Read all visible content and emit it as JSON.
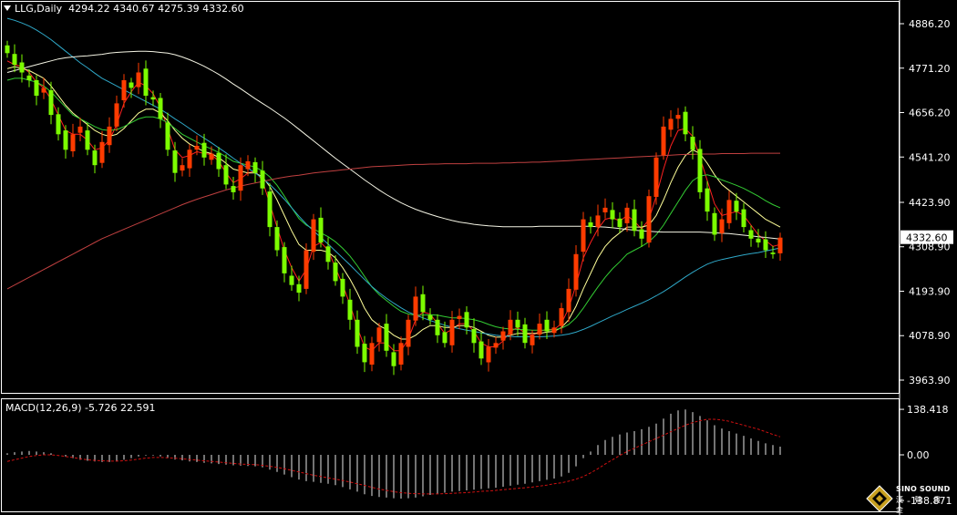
{
  "header": {
    "symbol": "LLG,Daily",
    "ohlc": "4294.22 4340.67 4275.39 4332.60"
  },
  "macd_header": {
    "label": "MACD(12,26,9) -5.726 22.591"
  },
  "logo": {
    "text": "SINO SOUND",
    "cn": "漢 聲 貴 金"
  },
  "colors": {
    "background": "#000000",
    "up_candle": "#ff3b00",
    "down_candle": "#7cfc00",
    "ma_fast": "#ff2020",
    "ma_mid": "#ffff99",
    "ma_green": "#33cc33",
    "ma_cyan": "#2fa8c8",
    "ma_white": "#f4f4e4",
    "ma_long": "#c04040",
    "macd_hist": "#e6e6e6",
    "macd_signal": "#d01010",
    "grid": "#888888"
  },
  "chart_data": [
    {
      "type": "candlestick",
      "title": "LLG,Daily",
      "y_ticks": [
        "4886.20",
        "4771.20",
        "4656.20",
        "4541.20",
        "4423.90",
        "4308.90",
        "4193.90",
        "4078.90",
        "3963.90"
      ],
      "ylim": [
        3930,
        4940
      ],
      "last_price": "4332.60",
      "grid": false,
      "series": [
        {
          "name": "price",
          "close": [
            4810,
            4780,
            4760,
            4740,
            4700,
            4720,
            4650,
            4600,
            4560,
            4600,
            4620,
            4560,
            4520,
            4580,
            4620,
            4680,
            4740,
            4720,
            4760,
            4700,
            4690,
            4640,
            4560,
            4500,
            4520,
            4560,
            4570,
            4540,
            4550,
            4510,
            4470,
            4450,
            4520,
            4530,
            4500,
            4460,
            4360,
            4300,
            4240,
            4210,
            4190,
            4300,
            4380,
            4320,
            4270,
            4220,
            4180,
            4120,
            4050,
            4010,
            4060,
            4100,
            4040,
            4000,
            4060,
            4120,
            4180,
            4140,
            4120,
            4080,
            4060,
            4120,
            4130,
            4100,
            4060,
            4020,
            4050,
            4060,
            4090,
            4120,
            4100,
            4060,
            4080,
            4110,
            4090,
            4100,
            4150,
            4200,
            4290,
            4380,
            4360,
            4390,
            4410,
            4380,
            4360,
            4410,
            4350,
            4330,
            4440,
            4540,
            4620,
            4640,
            4650,
            4600,
            4560,
            4450,
            4400,
            4340,
            4380,
            4430,
            4400,
            4360,
            4330,
            4320,
            4300,
            4290,
            4332.6
          ]
        },
        {
          "name": "fast",
          "values": [
            4790,
            4780,
            4775,
            4760,
            4735,
            4720,
            4690,
            4650,
            4610,
            4600,
            4600,
            4585,
            4560,
            4565,
            4585,
            4625,
            4680,
            4710,
            4735,
            4725,
            4705,
            4670,
            4615,
            4560,
            4540,
            4545,
            4555,
            4550,
            4548,
            4530,
            4500,
            4475,
            4485,
            4500,
            4505,
            4480,
            4420,
            4360,
            4300,
            4255,
            4220,
            4250,
            4310,
            4320,
            4300,
            4255,
            4210,
            4160,
            4100,
            4050,
            4040,
            4060,
            4060,
            4040,
            4040,
            4070,
            4120,
            4140,
            4135,
            4110,
            4085,
            4095,
            4110,
            4110,
            4090,
            4060,
            4050,
            4050,
            4065,
            4090,
            4100,
            4085,
            4080,
            4090,
            4095,
            4095,
            4110,
            4150,
            4210,
            4280,
            4320,
            4355,
            4380,
            4385,
            4375,
            4390,
            4375,
            4355,
            4380,
            4440,
            4510,
            4570,
            4610,
            4615,
            4595,
            4540,
            4480,
            4420,
            4390,
            4395,
            4400,
            4390,
            4365,
            4340,
            4325,
            4310,
            4315
          ]
        },
        {
          "name": "mid",
          "values": [
            4770,
            4775,
            4770,
            4765,
            4755,
            4745,
            4725,
            4700,
            4675,
            4655,
            4640,
            4625,
            4610,
            4600,
            4595,
            4600,
            4615,
            4635,
            4655,
            4665,
            4665,
            4655,
            4635,
            4610,
            4590,
            4575,
            4565,
            4555,
            4550,
            4540,
            4525,
            4510,
            4505,
            4500,
            4500,
            4490,
            4465,
            4430,
            4390,
            4350,
            4315,
            4300,
            4300,
            4300,
            4295,
            4280,
            4255,
            4225,
            4190,
            4150,
            4120,
            4105,
            4095,
            4080,
            4070,
            4070,
            4080,
            4095,
            4105,
            4105,
            4100,
            4100,
            4105,
            4105,
            4100,
            4090,
            4080,
            4075,
            4075,
            4080,
            4085,
            4085,
            4085,
            4085,
            4088,
            4090,
            4100,
            4120,
            4155,
            4200,
            4240,
            4280,
            4310,
            4330,
            4345,
            4360,
            4360,
            4360,
            4365,
            4390,
            4430,
            4475,
            4515,
            4545,
            4560,
            4550,
            4525,
            4495,
            4470,
            4455,
            4440,
            4425,
            4410,
            4395,
            4380,
            4370,
            4360
          ]
        },
        {
          "name": "green",
          "values": [
            4740,
            4745,
            4745,
            4740,
            4735,
            4725,
            4710,
            4690,
            4670,
            4650,
            4640,
            4630,
            4620,
            4612,
            4610,
            4612,
            4620,
            4630,
            4640,
            4645,
            4645,
            4640,
            4630,
            4615,
            4600,
            4590,
            4580,
            4570,
            4562,
            4553,
            4542,
            4530,
            4525,
            4520,
            4515,
            4505,
            4490,
            4468,
            4440,
            4410,
            4382,
            4365,
            4355,
            4345,
            4335,
            4322,
            4305,
            4285,
            4260,
            4232,
            4205,
            4185,
            4170,
            4155,
            4142,
            4135,
            4132,
            4132,
            4133,
            4132,
            4128,
            4125,
            4125,
            4123,
            4120,
            4115,
            4108,
            4102,
            4098,
            4096,
            4095,
            4094,
            4093,
            4093,
            4093,
            4094,
            4098,
            4108,
            4125,
            4150,
            4178,
            4205,
            4230,
            4252,
            4270,
            4290,
            4300,
            4310,
            4322,
            4340,
            4365,
            4395,
            4425,
            4455,
            4480,
            4492,
            4495,
            4490,
            4482,
            4475,
            4468,
            4460,
            4450,
            4440,
            4428,
            4418,
            4410
          ]
        },
        {
          "name": "cyan",
          "values": [
            4900,
            4895,
            4888,
            4880,
            4870,
            4858,
            4845,
            4830,
            4815,
            4800,
            4785,
            4772,
            4758,
            4745,
            4735,
            4725,
            4715,
            4705,
            4695,
            4685,
            4675,
            4665,
            4653,
            4640,
            4628,
            4615,
            4602,
            4590,
            4578,
            4565,
            4552,
            4538,
            4525,
            4512,
            4500,
            4486,
            4470,
            4452,
            4432,
            4410,
            4388,
            4368,
            4350,
            4333,
            4316,
            4298,
            4280,
            4262,
            4243,
            4224,
            4206,
            4190,
            4176,
            4163,
            4151,
            4140,
            4132,
            4125,
            4118,
            4112,
            4106,
            4101,
            4097,
            4093,
            4090,
            4086,
            4083,
            4080,
            4078,
            4077,
            4076,
            4076,
            4076,
            4076,
            4077,
            4078,
            4080,
            4083,
            4088,
            4095,
            4103,
            4112,
            4121,
            4130,
            4138,
            4147,
            4155,
            4163,
            4172,
            4182,
            4193,
            4205,
            4218,
            4231,
            4243,
            4254,
            4264,
            4271,
            4276,
            4280,
            4284,
            4288,
            4291,
            4294,
            4298,
            4302,
            4306
          ]
        },
        {
          "name": "white",
          "values": [
            4760,
            4765,
            4770,
            4775,
            4780,
            4785,
            4790,
            4795,
            4798,
            4800,
            4802,
            4803,
            4805,
            4807,
            4810,
            4812,
            4813,
            4814,
            4815,
            4815,
            4814,
            4812,
            4810,
            4806,
            4800,
            4793,
            4785,
            4776,
            4766,
            4755,
            4743,
            4730,
            4718,
            4705,
            4692,
            4680,
            4668,
            4655,
            4642,
            4628,
            4613,
            4598,
            4583,
            4568,
            4553,
            4538,
            4524,
            4510,
            4496,
            4482,
            4469,
            4456,
            4444,
            4433,
            4423,
            4414,
            4406,
            4399,
            4393,
            4387,
            4382,
            4377,
            4373,
            4370,
            4367,
            4365,
            4363,
            4362,
            4361,
            4361,
            4361,
            4361,
            4361,
            4362,
            4362,
            4362,
            4362,
            4362,
            4362,
            4362,
            4362,
            4361,
            4360,
            4358,
            4356,
            4354,
            4352,
            4350,
            4349,
            4348,
            4347,
            4347,
            4347,
            4347,
            4347,
            4347,
            4346,
            4345,
            4344,
            4343,
            4341,
            4339,
            4337,
            4335,
            4333,
            4331,
            4329
          ]
        },
        {
          "name": "long",
          "values": [
            4200,
            4210,
            4220,
            4230,
            4240,
            4250,
            4260,
            4270,
            4280,
            4290,
            4300,
            4310,
            4320,
            4330,
            4338,
            4346,
            4354,
            4362,
            4370,
            4378,
            4386,
            4394,
            4402,
            4410,
            4418,
            4425,
            4432,
            4438,
            4444,
            4450,
            4456,
            4461,
            4466,
            4470,
            4474,
            4478,
            4482,
            4486,
            4489,
            4492,
            4494,
            4497,
            4500,
            4502,
            4504,
            4506,
            4508,
            4510,
            4512,
            4514,
            4516,
            4517,
            4518,
            4519,
            4520,
            4521,
            4522,
            4522,
            4523,
            4523,
            4524,
            4524,
            4524,
            4524,
            4525,
            4525,
            4525,
            4525,
            4526,
            4526,
            4527,
            4527,
            4528,
            4528,
            4529,
            4530,
            4531,
            4532,
            4533,
            4534,
            4535,
            4536,
            4537,
            4538,
            4539,
            4540,
            4541,
            4542,
            4543,
            4544,
            4545,
            4546,
            4547,
            4548,
            4548,
            4549,
            4549,
            4549,
            4550,
            4550,
            4550,
            4550,
            4551,
            4551,
            4551,
            4551,
            4551
          ]
        }
      ]
    },
    {
      "type": "bar",
      "title": "MACD(12,26,9)",
      "y_ticks": [
        "138.418",
        "0.00",
        "-138.871"
      ],
      "ylim": [
        -160,
        150
      ],
      "grid": false,
      "series": [
        {
          "name": "histogram",
          "values": [
            5,
            8,
            10,
            12,
            10,
            8,
            5,
            0,
            -5,
            -10,
            -15,
            -18,
            -20,
            -22,
            -22,
            -20,
            -15,
            -10,
            -5,
            -2,
            -2,
            -5,
            -10,
            -14,
            -17,
            -20,
            -22,
            -24,
            -26,
            -28,
            -30,
            -32,
            -33,
            -34,
            -35,
            -38,
            -45,
            -52,
            -60,
            -68,
            -75,
            -80,
            -82,
            -85,
            -88,
            -92,
            -98,
            -105,
            -112,
            -120,
            -125,
            -128,
            -130,
            -132,
            -133,
            -132,
            -130,
            -126,
            -122,
            -118,
            -115,
            -112,
            -110,
            -108,
            -106,
            -104,
            -102,
            -100,
            -97,
            -94,
            -91,
            -88,
            -84,
            -80,
            -76,
            -72,
            -66,
            -55,
            -35,
            -10,
            10,
            30,
            45,
            55,
            62,
            68,
            72,
            78,
            85,
            95,
            110,
            125,
            135,
            138,
            130,
            118,
            105,
            90,
            80,
            72,
            65,
            58,
            50,
            42,
            35,
            30,
            25
          ]
        },
        {
          "name": "signal",
          "values": [
            -20,
            -15,
            -10,
            -5,
            -2,
            0,
            0,
            -2,
            -5,
            -8,
            -12,
            -15,
            -17,
            -18,
            -19,
            -19,
            -18,
            -16,
            -13,
            -10,
            -8,
            -8,
            -9,
            -10,
            -12,
            -14,
            -16,
            -18,
            -20,
            -22,
            -24,
            -26,
            -28,
            -29,
            -30,
            -32,
            -35,
            -38,
            -42,
            -47,
            -52,
            -57,
            -62,
            -66,
            -70,
            -74,
            -78,
            -83,
            -88,
            -93,
            -99,
            -104,
            -108,
            -112,
            -115,
            -117,
            -118,
            -119,
            -119,
            -119,
            -118,
            -117,
            -116,
            -115,
            -113,
            -111,
            -110,
            -108,
            -106,
            -104,
            -102,
            -100,
            -98,
            -95,
            -92,
            -88,
            -85,
            -80,
            -74,
            -66,
            -55,
            -42,
            -28,
            -15,
            -2,
            10,
            20,
            30,
            40,
            50,
            60,
            70,
            80,
            90,
            98,
            104,
            108,
            108,
            106,
            102,
            96,
            90,
            84,
            78,
            70,
            62,
            55
          ]
        }
      ]
    }
  ]
}
